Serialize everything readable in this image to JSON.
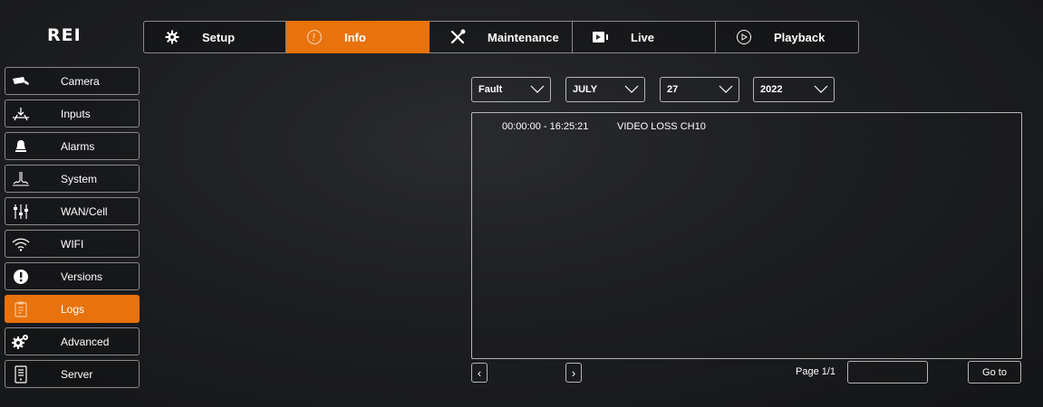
{
  "brand": {
    "logo": "REI"
  },
  "colors": {
    "accent": "#e8720c",
    "background": "#1d1e21",
    "border": "#8a8a8a"
  },
  "topnav": [
    {
      "label": "Setup",
      "icon": "gear-icon",
      "active": false
    },
    {
      "label": "Info",
      "icon": "info-icon",
      "active": true
    },
    {
      "label": "Maintenance",
      "icon": "tools-icon",
      "active": false
    },
    {
      "label": "Live",
      "icon": "video-camera-icon",
      "active": false
    },
    {
      "label": "Playback",
      "icon": "playback-icon",
      "active": false
    }
  ],
  "sidebar": [
    {
      "label": "Camera",
      "icon": "camera-icon"
    },
    {
      "label": "Inputs",
      "icon": "inputs-icon"
    },
    {
      "label": "Alarms",
      "icon": "bell-icon"
    },
    {
      "label": "System",
      "icon": "system-icon"
    },
    {
      "label": "WAN/Cell",
      "icon": "sliders-icon"
    },
    {
      "label": "WIFI",
      "icon": "wifi-icon"
    },
    {
      "label": "Versions",
      "icon": "info-circle-icon"
    },
    {
      "label": "Logs",
      "icon": "logs-icon",
      "active": true
    },
    {
      "label": "Advanced",
      "icon": "gears-icon"
    },
    {
      "label": "Server",
      "icon": "server-icon"
    }
  ],
  "filters": {
    "type": "Fault",
    "month": "JULY",
    "day": "27",
    "year": "2022"
  },
  "logs": [
    {
      "time": "00:00:00 - 16:25:21",
      "event": "VIDEO LOSS CH10"
    }
  ],
  "pagination": {
    "prev": "‹",
    "next": "›",
    "page_label": "Page 1/1",
    "goto_value": "",
    "goto_label": "Go to"
  }
}
